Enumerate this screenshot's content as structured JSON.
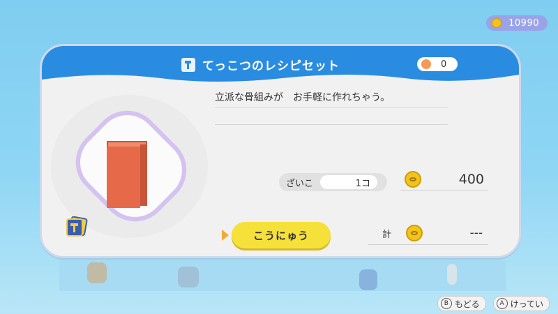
{
  "coins": {
    "icon": "coin-icon",
    "value": "10990"
  },
  "shop": {
    "title": "てっこつのレシピセット",
    "owned_count": "0",
    "description_line1": "立派な骨組みが　お手軽に作れちゃう。",
    "stock_label": "ざいこ",
    "stock_value": "1コ",
    "price": "400",
    "buy_label": "こうにゅう",
    "total_label": "計",
    "total_value": "---"
  },
  "hints": [
    {
      "key": "B",
      "label": "もどる"
    },
    {
      "key": "A",
      "label": "けってい"
    }
  ],
  "colors": {
    "header": "#2a8ce0",
    "button": "#f6e03a",
    "frame": "#d4c2f0",
    "coin": "#f5c21c"
  }
}
